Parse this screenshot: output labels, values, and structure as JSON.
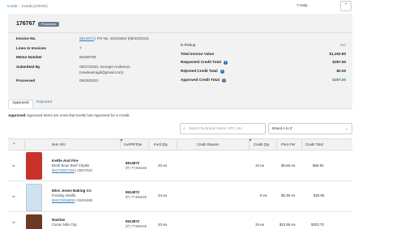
{
  "breadcrumb": {
    "link": "Credit",
    "current": "Credit (176767)"
  },
  "header": {
    "help_label": "Help",
    "collapse_glyph": "⌃"
  },
  "invoice": {
    "title": "176767",
    "status": "Processed",
    "left_fields": [
      {
        "label": "Invoice No.",
        "link": "8614872",
        "value": " | PO No. 20319262 (09/22/2023)"
      },
      {
        "label": "Lines In Invoices",
        "value": "7"
      },
      {
        "label": "Memo Number",
        "value": "55339759"
      },
      {
        "label": "Submitted By",
        "value": "09/27/2023, Georgie Anderson",
        "value2": "(newleasnigd@gmail.com)"
      },
      {
        "label": "Processed",
        "value": "09/28/2023"
      }
    ],
    "right_fields": [
      {
        "label": "E-Pickup",
        "value": "NO"
      },
      {
        "label": "Total Invoice Value",
        "value": "$1,202.80"
      },
      {
        "label": "Requested Credit Total",
        "value": "$287.50"
      },
      {
        "label": "Rejected Credit Total",
        "value": "$0.00"
      },
      {
        "label": "Approved Credit Total",
        "value": "$287.50"
      }
    ]
  },
  "tabs": {
    "approved": "Approved",
    "rejected": "Rejected"
  },
  "approved_note": {
    "strong": "Approved",
    "text": "Approved Items are ones that KeHE has Approved for a Credit."
  },
  "toolbar": {
    "search_placeholder": "Search by Brand, Name, UPC, etc.",
    "sort_value": "Brand A to Z"
  },
  "table": {
    "columns": [
      "Item Info",
      "Inv/PR/Tote",
      "Inv'd Qty",
      "Credit Reason",
      "Credit Qty",
      "Price Per",
      "Credit Total"
    ],
    "rows": [
      {
        "brand": "Kettle And Fire",
        "desc": "Broth Bone Beef Chpble",
        "upc": "851702007428",
        "item_no": "00537554",
        "inv": "8614872",
        "tote": "(P) 77456245",
        "inv_qty": "20 ea",
        "credit_qty": "10 ea",
        "price": "$5.69 ea",
        "total": "$56.90",
        "thumb_color": "#c8322b"
      },
      {
        "brand": "Miss Jones Baking Co",
        "desc": "Frosting Vanilla",
        "upc": "850475006005",
        "item_no": "00491989",
        "inv": "8614872",
        "tote": "(P) 77456245",
        "inv_qty": "24 ea",
        "credit_qty": "5 ea",
        "price": "$5.39 ea",
        "total": "$26.95",
        "thumb_color": "#cfe3ee"
      },
      {
        "brand": "Navitas",
        "desc": "Cacao Nibs Org",
        "upc": "",
        "item_no": "",
        "inv": "8614872",
        "tote": "(P) 77456245",
        "inv_qty": "20 ea",
        "credit_qty": "15 ea",
        "price": "$13.58 ea",
        "total": "$203.70",
        "thumb_color": "#6b3a22"
      }
    ]
  }
}
